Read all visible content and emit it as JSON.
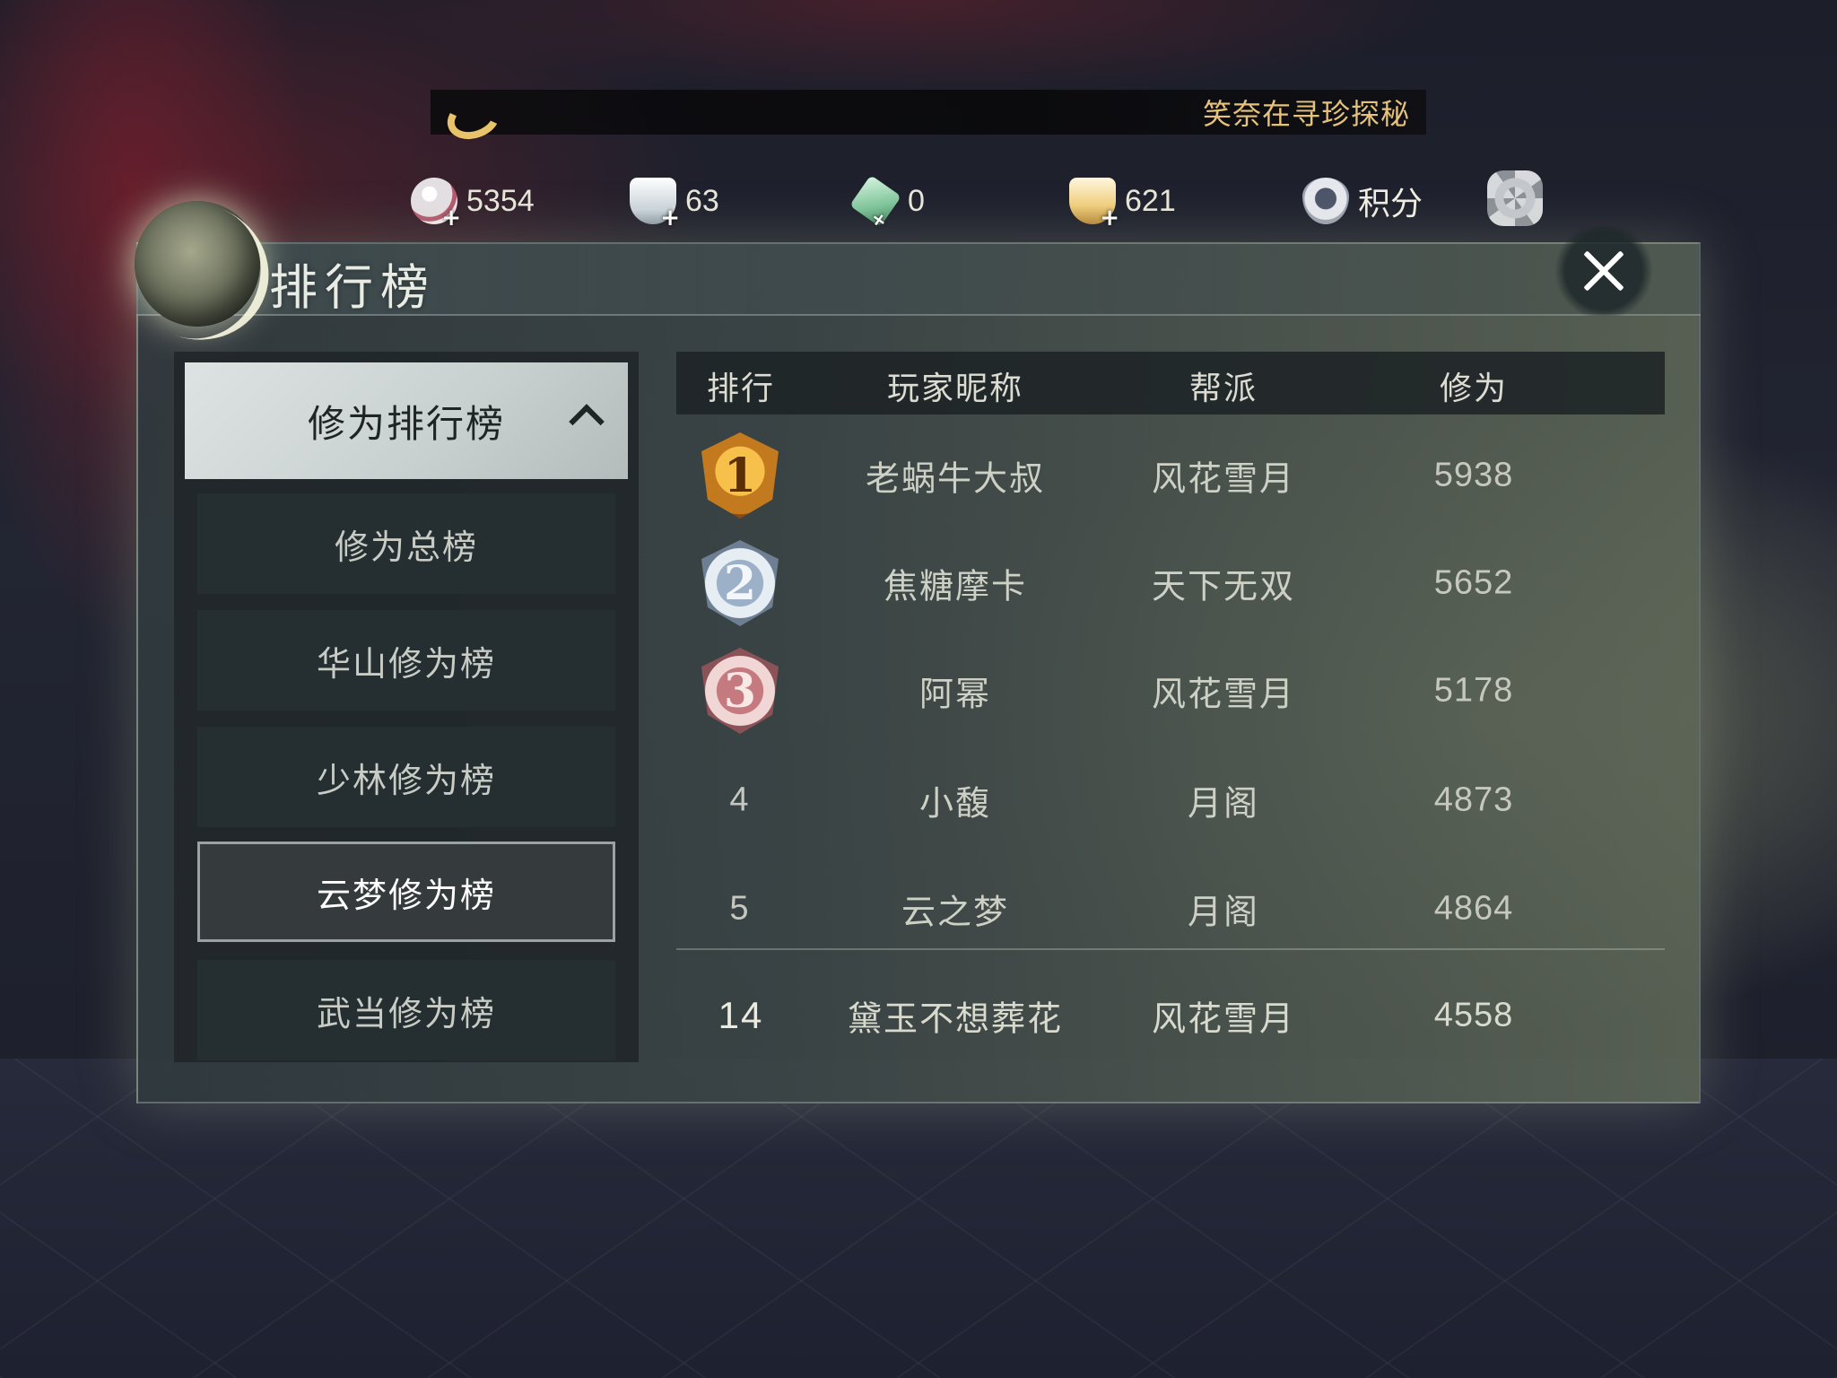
{
  "ticker": {
    "text": "笑奈在寻珍探秘"
  },
  "currencies": [
    {
      "icon": "coin-icon",
      "value": "5354"
    },
    {
      "icon": "silver-ingot-icon",
      "value": "63"
    },
    {
      "icon": "jade-icon",
      "value": "0"
    },
    {
      "icon": "gold-ingot-icon",
      "value": "621"
    }
  ],
  "score": {
    "icon": "badge-icon",
    "label": "积分"
  },
  "panel": {
    "title": "排行榜"
  },
  "menu": {
    "header": "修为排行榜",
    "items": [
      {
        "label": "修为总榜",
        "active": false
      },
      {
        "label": "华山修为榜",
        "active": false
      },
      {
        "label": "少林修为榜",
        "active": false
      },
      {
        "label": "云梦修为榜",
        "active": true
      },
      {
        "label": "武当修为榜",
        "active": false
      }
    ]
  },
  "table": {
    "columns": [
      "排行",
      "玩家昵称",
      "帮派",
      "修为"
    ],
    "rows": [
      {
        "rank": "1",
        "name": "老蜗牛大叔",
        "guild": "风花雪月",
        "score": "5938"
      },
      {
        "rank": "2",
        "name": "焦糖摩卡",
        "guild": "天下无双",
        "score": "5652"
      },
      {
        "rank": "3",
        "name": "阿幂",
        "guild": "风花雪月",
        "score": "5178"
      },
      {
        "rank": "4",
        "name": "小馥",
        "guild": "月阁",
        "score": "4873"
      },
      {
        "rank": "5",
        "name": "云之梦",
        "guild": "月阁",
        "score": "4864"
      }
    ],
    "self_row": {
      "rank": "14",
      "name": "黛玉不想葬花",
      "guild": "风花雪月",
      "score": "4558"
    }
  }
}
